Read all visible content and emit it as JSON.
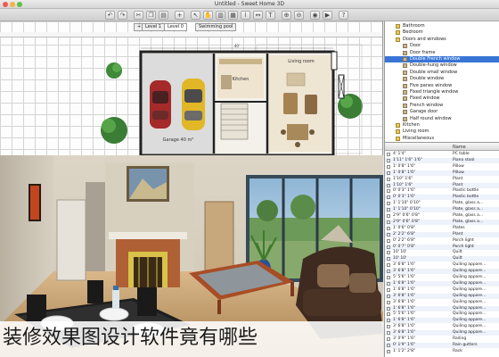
{
  "window": {
    "title": "Untitled - Sweet Home 3D"
  },
  "plan": {
    "tabs": [
      {
        "label": "Swimming pool"
      },
      {
        "label": "Level 0"
      },
      {
        "label": "Level 1"
      }
    ],
    "room_labels": {
      "garage": "Garage 40 m²",
      "kitchen": "Kitchen",
      "living": "Living room",
      "bedroom": "Bedroom"
    }
  },
  "catalog": {
    "items": [
      {
        "label": "Bathroom",
        "folder": true
      },
      {
        "label": "Bedroom",
        "folder": true
      },
      {
        "label": "Doors and windows",
        "folder": true
      },
      {
        "label": "Door",
        "folder": false
      },
      {
        "label": "Door frame",
        "folder": false
      },
      {
        "label": "Double French window",
        "folder": false,
        "selected": true
      },
      {
        "label": "Double-hung window",
        "folder": false
      },
      {
        "label": "Double small window",
        "folder": false
      },
      {
        "label": "Double window",
        "folder": false
      },
      {
        "label": "Five panes window",
        "folder": false
      },
      {
        "label": "Fixed triangle window",
        "folder": false
      },
      {
        "label": "Fixed window",
        "folder": false
      },
      {
        "label": "French window",
        "folder": false
      },
      {
        "label": "Garage door",
        "folder": false
      },
      {
        "label": "Half round window",
        "folder": false
      },
      {
        "label": "Kitchen",
        "folder": true
      },
      {
        "label": "Living room",
        "folder": true
      },
      {
        "label": "Miscellaneous",
        "folder": true
      }
    ]
  },
  "furniture": {
    "header": "Name",
    "rows": [
      {
        "dims": "4' 1'4\"",
        "name": "PC table"
      },
      {
        "dims": "1'11\" 1'6\" 1'6\"",
        "name": "Piano stool"
      },
      {
        "dims": "1' 0'8\" 1'6\"",
        "name": "Pillow"
      },
      {
        "dims": "1' 0'8\" 1'6\"",
        "name": "Pillow"
      },
      {
        "dims": "1'10\" 1'6\"",
        "name": "Plant"
      },
      {
        "dims": "1'10\" 1'6\"",
        "name": "Plant"
      },
      {
        "dims": "0' 0'3\" 1'6\"",
        "name": "Plastic bottle"
      },
      {
        "dims": "0' 0'3\" 1'6\"",
        "name": "Plastic bottle"
      },
      {
        "dims": "1' 1'10\" 0'10\"",
        "name": "Plate, glass a..."
      },
      {
        "dims": "1' 1'10\" 0'10\"",
        "name": "Plate, glass a..."
      },
      {
        "dims": "2'9\" 0'6\" 0'8\"",
        "name": "Plate, glass a..."
      },
      {
        "dims": "2'9\" 0'6\" 0'8\"",
        "name": "Plate, glass a..."
      },
      {
        "dims": "1' 0'6\" 0'8\"",
        "name": "Plates"
      },
      {
        "dims": "2' 2'2\" 6'8\"",
        "name": "Plant"
      },
      {
        "dims": "0' 2'2\" 6'8\"",
        "name": "Porch light"
      },
      {
        "dims": "0' 0'7\" 0'8\"",
        "name": "Porch light"
      },
      {
        "dims": "10' 10'",
        "name": "Quilt"
      },
      {
        "dims": "10' 10'",
        "name": "Quilt"
      },
      {
        "dims": "3' 6'8\" 1'6\"",
        "name": "Quiling appare..."
      },
      {
        "dims": "3' 6'8\" 1'6\"",
        "name": "Quiling appare..."
      },
      {
        "dims": "5' 5'6\" 1'6\"",
        "name": "Quiling appare..."
      },
      {
        "dims": "1' 6'8\" 1'6\"",
        "name": "Quiling appare..."
      },
      {
        "dims": "1' 6'8\" 1'6\"",
        "name": "Quiling appare..."
      },
      {
        "dims": "3' 6'8\" 1'6\"",
        "name": "Quiling appare..."
      },
      {
        "dims": "3' 6'8\" 1'6\"",
        "name": "Quiling appare..."
      },
      {
        "dims": "1' 6'8\" 1'6\"",
        "name": "Quiling appare..."
      },
      {
        "dims": "5' 5'6\" 1'6\"",
        "name": "Quiling appare..."
      },
      {
        "dims": "1' 6'8\" 1'6\"",
        "name": "Quiling appare..."
      },
      {
        "dims": "3' 6'8\" 1'6\"",
        "name": "Quiling appare..."
      },
      {
        "dims": "3' 6'8\" 1'6\"",
        "name": "Quiling appare..."
      },
      {
        "dims": "3' 0'9\" 1'6\"",
        "name": "Railing"
      },
      {
        "dims": "0' 1'9\" 1'6\"",
        "name": "Rain gutters"
      },
      {
        "dims": "1' 1'2\" 2'8\"",
        "name": "Rack"
      }
    ]
  },
  "caption": {
    "text": "装修效果图设计软件竟有哪些"
  }
}
